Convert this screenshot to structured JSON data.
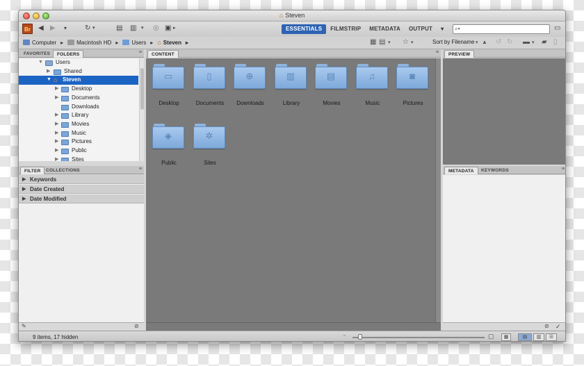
{
  "window": {
    "title": "Steven"
  },
  "toolbar": {
    "app_badge": "Br",
    "workspaces": [
      "ESSENTIALS",
      "FILMSTRIP",
      "METADATA",
      "OUTPUT"
    ],
    "active_workspace": "ESSENTIALS",
    "search_placeholder": "⌕▾"
  },
  "path_bar": {
    "crumbs": [
      "Computer",
      "Macintosh HD",
      "Users",
      "Steven"
    ],
    "sort_label": "Sort by Filename"
  },
  "left_top_panel": {
    "tabs": [
      "FAVORITES",
      "FOLDERS"
    ],
    "active_tab": "FOLDERS",
    "tree": [
      {
        "label": "Users",
        "level": 0,
        "expanded": true
      },
      {
        "label": "Shared",
        "level": 1,
        "expanded": false
      },
      {
        "label": "Steven",
        "level": 1,
        "expanded": true,
        "selected": true,
        "home": true
      },
      {
        "label": "Desktop",
        "level": 2
      },
      {
        "label": "Documents",
        "level": 2
      },
      {
        "label": "Downloads",
        "level": 2
      },
      {
        "label": "Library",
        "level": 2
      },
      {
        "label": "Movies",
        "level": 2
      },
      {
        "label": "Music",
        "level": 2
      },
      {
        "label": "Pictures",
        "level": 2
      },
      {
        "label": "Public",
        "level": 2
      },
      {
        "label": "Sites",
        "level": 2
      }
    ]
  },
  "left_bottom_panel": {
    "tabs": [
      "FILTER",
      "COLLECTIONS"
    ],
    "active_tab": "FILTER",
    "filters": [
      "Keywords",
      "Date Created",
      "Date Modified"
    ]
  },
  "content_panel": {
    "tab": "CONTENT",
    "items": [
      {
        "label": "Desktop",
        "icon": "desktop-emblem"
      },
      {
        "label": "Documents",
        "icon": "document-emblem"
      },
      {
        "label": "Downloads",
        "icon": "download-emblem"
      },
      {
        "label": "Library",
        "icon": "library-emblem"
      },
      {
        "label": "Movies",
        "icon": "film-emblem"
      },
      {
        "label": "Music",
        "icon": "music-emblem"
      },
      {
        "label": "Pictures",
        "icon": "camera-emblem"
      },
      {
        "label": "Public",
        "icon": "public-emblem"
      },
      {
        "label": "Sites",
        "icon": "compass-emblem"
      }
    ]
  },
  "right_top_panel": {
    "tab": "PREVIEW"
  },
  "right_bottom_panel": {
    "tabs": [
      "METADATA",
      "KEYWORDS"
    ],
    "active_tab": "METADATA"
  },
  "status": {
    "text": "9 items, 17 hidden"
  },
  "colors": {
    "accent": "#2f63b3",
    "selection": "#1c64c4",
    "content_bg": "#7a7a7a"
  }
}
